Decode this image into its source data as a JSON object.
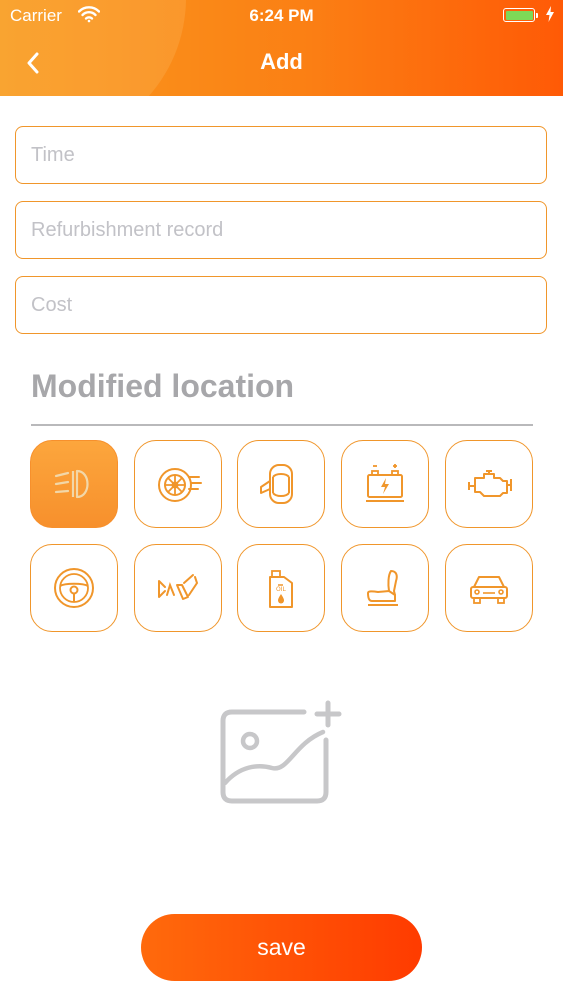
{
  "status_bar": {
    "carrier": "Carrier",
    "time": "6:24 PM",
    "icons": [
      "wifi-icon",
      "battery-icon",
      "charging-bolt-icon"
    ]
  },
  "nav": {
    "title": "Add",
    "back_icon": "chevron-left-icon"
  },
  "form": {
    "time_placeholder": "Time",
    "record_placeholder": "Refurbishment record",
    "cost_placeholder": "Cost"
  },
  "section": {
    "title": "Modified location"
  },
  "locations": [
    {
      "icon": "headlight-icon",
      "selected": true
    },
    {
      "icon": "tire-icon",
      "selected": false
    },
    {
      "icon": "car-door-icon",
      "selected": false
    },
    {
      "icon": "battery-icon",
      "selected": false
    },
    {
      "icon": "engine-icon",
      "selected": false
    },
    {
      "icon": "steering-wheel-icon",
      "selected": false
    },
    {
      "icon": "brake-pedal-icon",
      "selected": false
    },
    {
      "icon": "oil-can-icon",
      "selected": false
    },
    {
      "icon": "car-seat-icon",
      "selected": false
    },
    {
      "icon": "car-front-icon",
      "selected": false
    }
  ],
  "photo_icon": "add-image-icon",
  "save_label": "save",
  "colors": {
    "accent": "#f0962b",
    "header_start": "#f89a1e",
    "header_end": "#ff5a06",
    "save_button": "#ff4a05",
    "placeholder": "#c2c2c7"
  }
}
